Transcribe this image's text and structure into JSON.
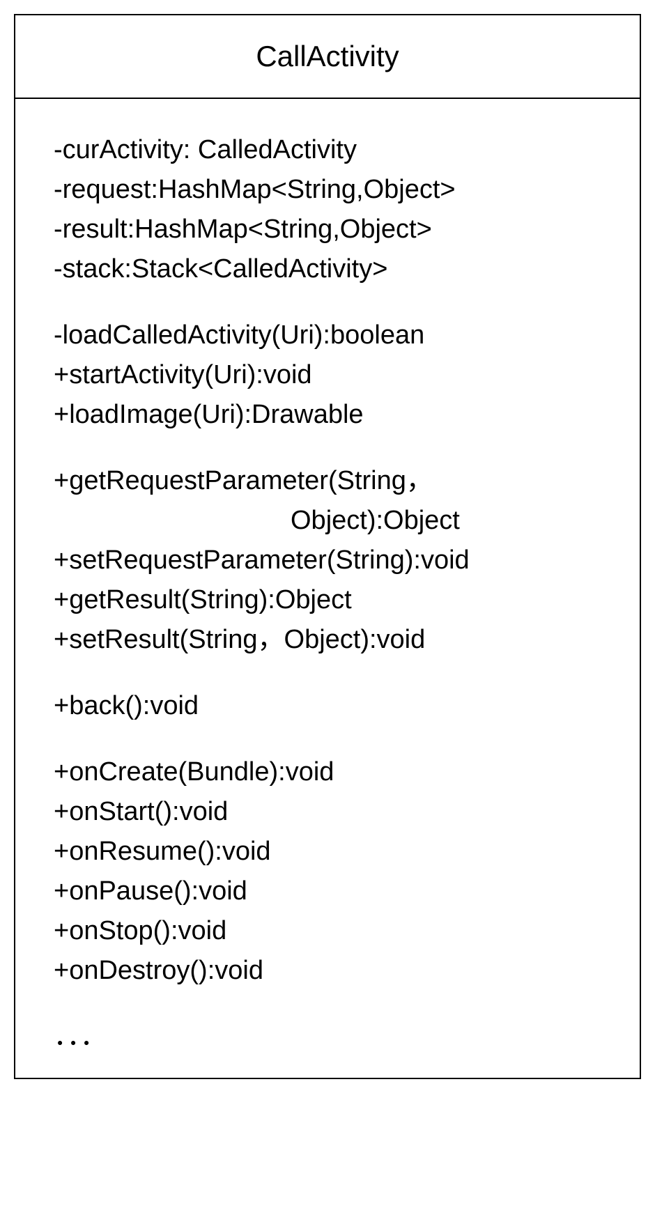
{
  "class": {
    "name": "CallActivity"
  },
  "attributes": [
    "-curActivity: CalledActivity",
    "-request:HashMap<String,Object>",
    "-result:HashMap<String,Object>",
    "-stack:Stack<CalledActivity>"
  ],
  "methods_group1": [
    "-loadCalledActivity(Uri):boolean",
    "+startActivity(Uri):void",
    "+loadImage(Uri):Drawable"
  ],
  "methods_group2": [
    "+getRequestParameter(String，",
    "Object):Object",
    "+setRequestParameter(String):void",
    "+getResult(String):Object",
    "+setResult(String，Object):void"
  ],
  "methods_group3": [
    "+back():void"
  ],
  "methods_group4": [
    "+onCreate(Bundle):void",
    "+onStart():void",
    "+onResume():void",
    "+onPause():void",
    "+onStop():void",
    "+onDestroy():void"
  ],
  "ellipsis": "．．．"
}
